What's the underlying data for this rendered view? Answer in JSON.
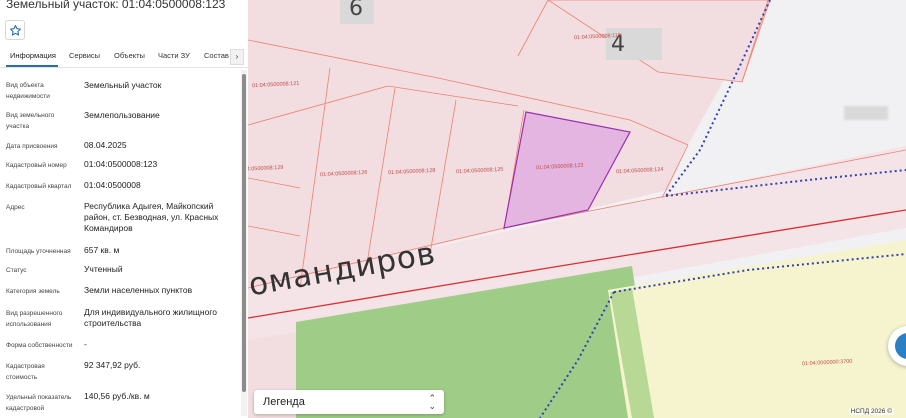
{
  "panel": {
    "title": "Земельный участок: 01:04:0500008:123",
    "tabs": [
      {
        "label": "Информация",
        "active": true
      },
      {
        "label": "Сервисы"
      },
      {
        "label": "Объекты"
      },
      {
        "label": "Части ЗУ"
      },
      {
        "label": "Состав"
      }
    ],
    "tab_next": "›",
    "rows": [
      {
        "label": "Вид объекта недвижимости",
        "value": "Земельный участок"
      },
      {
        "label": "Вид земельного участка",
        "value": "Землепользование"
      },
      {
        "label": "Дата присвоения",
        "value": "08.04.2025"
      },
      {
        "label": "Кадастровый номер",
        "value": "01:04:0500008:123"
      },
      {
        "label": "Кадастровый квартал",
        "value": "01:04:0500008"
      },
      {
        "label": "Адрес",
        "value": "Республика Адыгея, Майкопский район, ст. Безводная, ул. Красных Командиров"
      },
      {
        "label": "Площадь уточненная",
        "value": "657 кв. м"
      },
      {
        "label": "Статус",
        "value": "Учтенный"
      },
      {
        "label": "Категория земель",
        "value": "Земли населенных пунктов"
      },
      {
        "label": "Вид разрешенного использования",
        "value": "Для индивидуального жилищного строительства"
      },
      {
        "label": "Форма собственности",
        "value": "-"
      },
      {
        "label": "Кадастровая стоимость",
        "value": "92 347,92 руб."
      },
      {
        "label": "Удельный показатель кадастровой",
        "value": "140,56 руб./кв. м"
      }
    ]
  },
  "map": {
    "street_label": "омандиров",
    "house_numbers": [
      "6",
      "4"
    ],
    "plot_labels": [
      "01:04:0500008:119",
      "01:04:0500008:121",
      "01:04:0500008:129",
      "01:04:0500008:126",
      "01:04:0500008:128",
      "01:04:0500008:125",
      "01:04:0500008:123",
      "01:04:0500008:124",
      "01:04:0000000:3700"
    ],
    "legend_label": "Легенда",
    "copyright": "НСПД 2026 ©",
    "colors": {
      "parcel_fill": "#f2dde0",
      "parcel_border": "#f08070",
      "selected_fill": "#e4b5e0",
      "selected_border": "#9a2fb0",
      "road": "#f4e4e8",
      "green_zone": "#9fcc86",
      "yellow_zone": "#f6f4cf",
      "boundary_dots": "#3240b4",
      "road_line": "#d83030"
    }
  }
}
